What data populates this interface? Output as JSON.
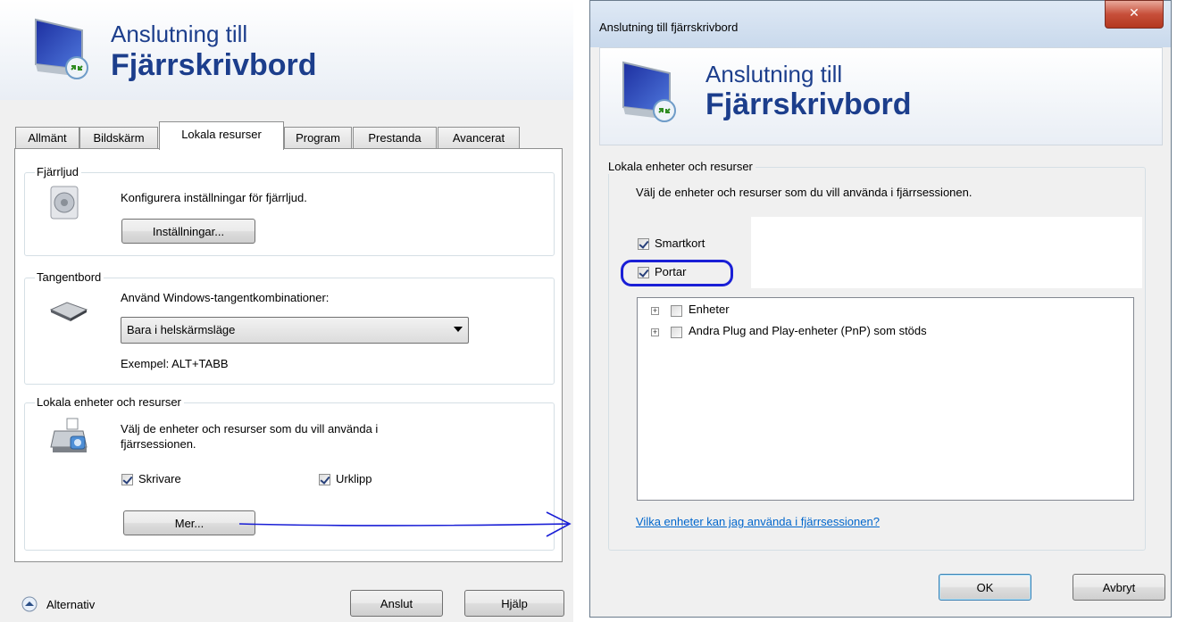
{
  "left": {
    "banner": {
      "line1": "Anslutning till",
      "line2": "Fjärrskrivbord"
    },
    "tabs": [
      {
        "label": "Allmänt",
        "active": false
      },
      {
        "label": "Bildskärm",
        "active": false
      },
      {
        "label": "Lokala resurser",
        "active": true
      },
      {
        "label": "Program",
        "active": false
      },
      {
        "label": "Prestanda",
        "active": false
      },
      {
        "label": "Avancerat",
        "active": false
      }
    ],
    "remote_audio": {
      "legend": "Fjärrljud",
      "description": "Konfigurera inställningar för fjärrljud.",
      "button": "Inställningar..."
    },
    "keyboard": {
      "legend": "Tangentbord",
      "description": "Använd Windows-tangentkombinationer:",
      "selected": "Bara i helskärmsläge",
      "example": "Exempel: ALT+TABB"
    },
    "local_devices": {
      "legend": "Lokala enheter och resurser",
      "description_line1": "Välj de enheter och resurser som du vill använda i",
      "description_line2": "fjärrsessionen.",
      "printers": {
        "label": "Skrivare",
        "checked": true
      },
      "clipboard": {
        "label": "Urklipp",
        "checked": true
      },
      "more_button": "Mer..."
    },
    "footer": {
      "options": "Alternativ",
      "connect": "Anslut",
      "help": "Hjälp"
    }
  },
  "right": {
    "window_title": "Anslutning till fjärrskrivbord",
    "close_glyph": "✕",
    "banner": {
      "line1": "Anslutning till",
      "line2": "Fjärrskrivbord"
    },
    "group": {
      "legend": "Lokala enheter och resurser",
      "description": "Välj de enheter och resurser som du vill använda i fjärrsessionen.",
      "smartcards": {
        "label": "Smartkort",
        "checked": true
      },
      "ports": {
        "label": "Portar",
        "checked": true
      },
      "tree": [
        {
          "label": "Enheter",
          "checked": false,
          "expander": "+"
        },
        {
          "label": "Andra Plug and Play-enheter (PnP) som stöds",
          "checked": false,
          "expander": "+"
        }
      ],
      "help_link": "Vilka enheter kan jag använda i fjärrsessionen?"
    },
    "buttons": {
      "ok": "OK",
      "cancel": "Avbryt"
    }
  },
  "colors": {
    "title_blue": "#1c3e8c",
    "annotation_blue": "#1a1fd6",
    "link_blue": "#0066cc"
  }
}
